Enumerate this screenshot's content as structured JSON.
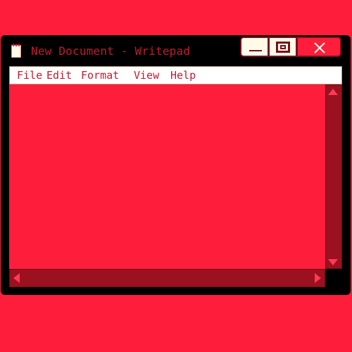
{
  "window": {
    "title": "New Document - Writepad",
    "icon": "notepad-icon",
    "controls": {
      "minimize_icon": "minimize-icon",
      "maximize_icon": "maximize-icon",
      "close_icon": "close-icon"
    }
  },
  "menu": {
    "items": [
      {
        "label": "File"
      },
      {
        "label": "Edit"
      },
      {
        "label": "Format"
      },
      {
        "label": "View"
      },
      {
        "label": "Help"
      }
    ]
  },
  "editor": {
    "content": ""
  },
  "colors": {
    "background": "#ff1d3c",
    "window_frame": "#000000",
    "title_text": "#c41a30",
    "menubar": "#ffffff",
    "scrollbar": "#9b111f",
    "button_face": "#fffbe9"
  }
}
